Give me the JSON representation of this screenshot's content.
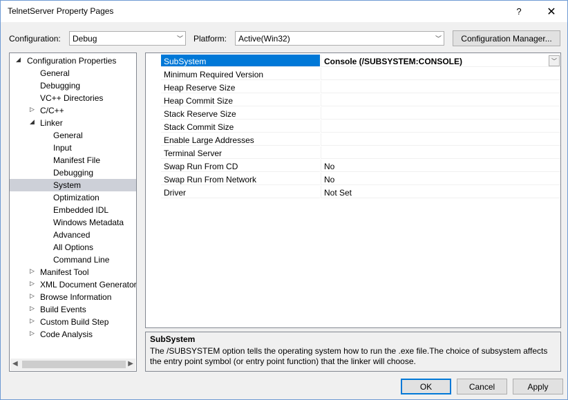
{
  "window": {
    "title": "TelnetServer Property Pages",
    "help_glyph": "?",
    "close_glyph": "✕"
  },
  "toolbar": {
    "configuration_label": "Configuration:",
    "configuration_value": "Debug",
    "platform_label": "Platform:",
    "platform_value": "Active(Win32)",
    "config_manager_label": "Configuration Manager..."
  },
  "tree": {
    "items": [
      {
        "label": "Configuration Properties",
        "expander": "◢"
      },
      {
        "label": "General",
        "expander": ""
      },
      {
        "label": "Debugging",
        "expander": ""
      },
      {
        "label": "VC++ Directories",
        "expander": ""
      },
      {
        "label": "C/C++",
        "expander": "▷"
      },
      {
        "label": "Linker",
        "expander": "◢"
      },
      {
        "label": "General",
        "expander": ""
      },
      {
        "label": "Input",
        "expander": ""
      },
      {
        "label": "Manifest File",
        "expander": ""
      },
      {
        "label": "Debugging",
        "expander": ""
      },
      {
        "label": "System",
        "expander": "",
        "selected": true
      },
      {
        "label": "Optimization",
        "expander": ""
      },
      {
        "label": "Embedded IDL",
        "expander": ""
      },
      {
        "label": "Windows Metadata",
        "expander": ""
      },
      {
        "label": "Advanced",
        "expander": ""
      },
      {
        "label": "All Options",
        "expander": ""
      },
      {
        "label": "Command Line",
        "expander": ""
      },
      {
        "label": "Manifest Tool",
        "expander": "▷"
      },
      {
        "label": "XML Document Generator",
        "expander": "▷"
      },
      {
        "label": "Browse Information",
        "expander": "▷"
      },
      {
        "label": "Build Events",
        "expander": "▷"
      },
      {
        "label": "Custom Build Step",
        "expander": "▷"
      },
      {
        "label": "Code Analysis",
        "expander": "▷"
      }
    ]
  },
  "properties": [
    {
      "name": "SubSystem",
      "value": "Console (/SUBSYSTEM:CONSOLE)",
      "selected": true
    },
    {
      "name": "Minimum Required Version",
      "value": ""
    },
    {
      "name": "Heap Reserve Size",
      "value": ""
    },
    {
      "name": "Heap Commit Size",
      "value": ""
    },
    {
      "name": "Stack Reserve Size",
      "value": ""
    },
    {
      "name": "Stack Commit Size",
      "value": ""
    },
    {
      "name": "Enable Large Addresses",
      "value": ""
    },
    {
      "name": "Terminal Server",
      "value": ""
    },
    {
      "name": "Swap Run From CD",
      "value": "No"
    },
    {
      "name": "Swap Run From Network",
      "value": "No"
    },
    {
      "name": "Driver",
      "value": "Not Set"
    }
  ],
  "description": {
    "title": "SubSystem",
    "text": "The /SUBSYSTEM option tells the operating system how to run the .exe file.The choice of subsystem affects the entry point symbol (or entry point function) that the linker will choose."
  },
  "buttons": {
    "ok": "OK",
    "cancel": "Cancel",
    "apply": "Apply"
  },
  "colors": {
    "selection": "#0078d7",
    "tree_selection": "#cdd0d8"
  }
}
